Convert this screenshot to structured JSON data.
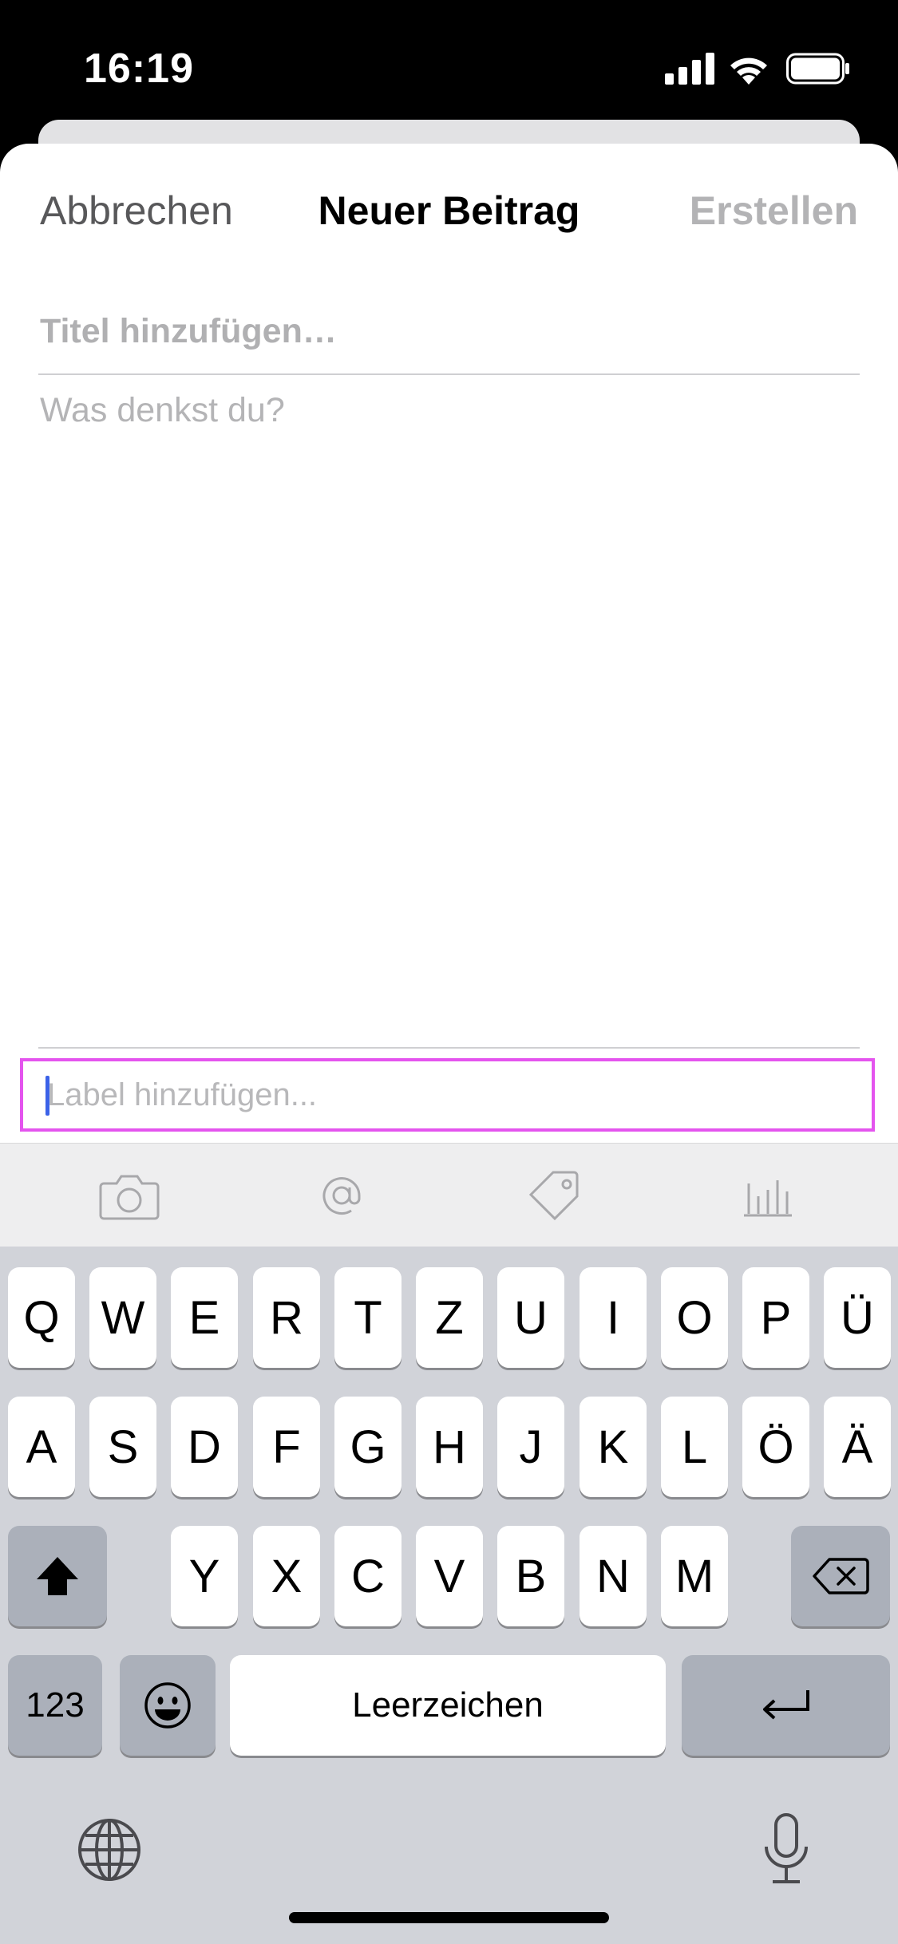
{
  "status_bar": {
    "time": "16:19"
  },
  "nav": {
    "cancel": "Abbrechen",
    "title": "Neuer Beitrag",
    "create": "Erstellen"
  },
  "form": {
    "title_placeholder": "Titel hinzufügen…",
    "body_placeholder": "Was denkst du?",
    "label_placeholder": "Label hinzufügen..."
  },
  "toolbar": {
    "icons": [
      "camera-icon",
      "at-icon",
      "tag-icon",
      "chart-icon"
    ]
  },
  "keyboard": {
    "row1": [
      "Q",
      "W",
      "E",
      "R",
      "T",
      "Z",
      "U",
      "I",
      "O",
      "P",
      "Ü"
    ],
    "row2": [
      "A",
      "S",
      "D",
      "F",
      "G",
      "H",
      "J",
      "K",
      "L",
      "Ö",
      "Ä"
    ],
    "row3": [
      "Y",
      "X",
      "C",
      "V",
      "B",
      "N",
      "M"
    ],
    "numbers": "123",
    "space": "Leerzeichen"
  },
  "colors": {
    "focus_outline": "#e454ee",
    "cursor": "#3b62e8"
  }
}
